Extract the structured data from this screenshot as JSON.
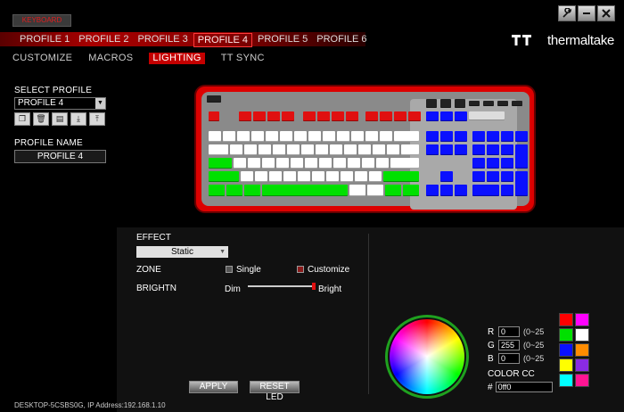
{
  "device_tab": "KEYBOARD",
  "window_controls": {
    "settings_icon": "wrench-icon",
    "minimize_icon": "minimize-icon",
    "close_icon": "close-icon"
  },
  "profiles": [
    "PROFILE 1",
    "PROFILE 2",
    "PROFILE 3",
    "PROFILE 4",
    "PROFILE 5",
    "PROFILE 6"
  ],
  "active_profile_index": 3,
  "brand": "thermaltake",
  "subtabs": [
    "CUSTOMIZE",
    "MACROS",
    "LIGHTING",
    "TT SYNC"
  ],
  "active_subtab_index": 2,
  "left_panel": {
    "select_profile_label": "SELECT PROFILE",
    "selected_profile": "PROFILE 4",
    "icons": [
      "copy-icon",
      "delete-icon",
      "paste-icon",
      "import-icon",
      "export-icon"
    ],
    "profile_name_label": "PROFILE NAME",
    "profile_name_value": "PROFILE 4"
  },
  "keyboard_colors": {
    "red": "#e01010",
    "white": "#ffffff",
    "green": "#00e000",
    "blue": "#0a10ff",
    "black": "#111111"
  },
  "lighting": {
    "effect_label": "EFFECT",
    "effect_value": "Static",
    "zone_label": "ZONE",
    "single_label": "Single",
    "customize_label": "Customize",
    "brightness_label": "BRIGHTN",
    "dim_label": "Dim",
    "bright_label": "Bright",
    "brightness_value": 100
  },
  "color": {
    "r_label": "R",
    "r_value": "0",
    "g_label": "G",
    "g_value": "255",
    "b_label": "B",
    "b_value": "0",
    "range_text": "(0~25",
    "color_code_label": "COLOR CC",
    "hex_prefix": "#",
    "hex_value": "0ff0",
    "swatches": [
      "#ff0000",
      "#ff00ff",
      "#00e000",
      "#ffffff",
      "#0a10ff",
      "#ff8c00",
      "#ffff00",
      "#8a2be2",
      "#00ffff",
      "#ff1493"
    ]
  },
  "buttons": {
    "apply": "APPLY",
    "reset": "RESET LED"
  },
  "footer": "DESKTOP-5CSBS0G, IP Address:192.168.1.10"
}
